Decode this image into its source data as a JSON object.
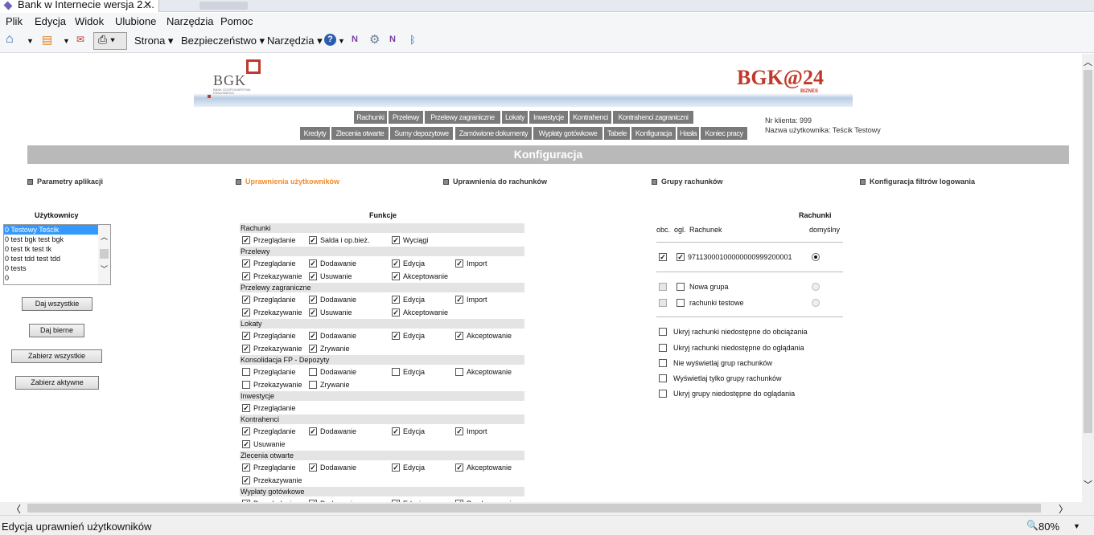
{
  "browser": {
    "tab_title": "Bank w Internecie wersja 2....",
    "tab_close": "✕",
    "menu": [
      "Plik",
      "Edycja",
      "Widok",
      "Ulubione",
      "Narzędzia",
      "Pomoc"
    ],
    "toolbar": {
      "strona": "Strona ▾",
      "bezpieczenstwo": "Bezpieczeństwo ▾",
      "narzedzia": "Narzędzia ▾"
    },
    "status_text": "Edycja uprawnień użytkowników",
    "zoom": "80%"
  },
  "banner": {
    "bgk": "BGK",
    "bgk_sub1": "BANK GOSPODARSTWA",
    "bgk_sub2": "KRAJOWEGO",
    "right_logo": "BGK@24",
    "right_sub": "BIZNES"
  },
  "nav": {
    "row1": [
      "Rachunki",
      "Przelewy",
      "Przelewy zagraniczne",
      "Lokaty",
      "Inwestycje",
      "Kontrahenci",
      "Kontrahenci zagraniczni"
    ],
    "row2": [
      "Kredyty",
      "Zlecenia otwarte",
      "Sumy depozytowe",
      "Zamówione dokumenty",
      "Wypłaty gotówkowe",
      "Tabele",
      "Konfiguracja",
      "Hasła",
      "Koniec pracy"
    ]
  },
  "client": {
    "nr_label": "Nr klienta: 999",
    "user_label": "Nazwa użytkownika: Teścik Testowy"
  },
  "section_title": "Konfiguracja",
  "sublinks": [
    "Parametry aplikacji",
    "Uprawnienia użytkowników",
    "Uprawnienia do rachunków",
    "Grupy rachunków",
    "Konfiguracja filtrów logowania"
  ],
  "users": {
    "heading": "Użytkownicy",
    "items": [
      "0 Testowy Teścik",
      "0 test bgk  test bgk",
      "0 test tk test tk",
      "0 test tdd test tdd",
      "0 tests",
      "0"
    ],
    "selected": 0,
    "buttons": [
      "Daj wszystkie",
      "Daj bierne",
      "Zabierz wszystkie",
      "Zabierz aktywne"
    ]
  },
  "functions": {
    "heading": "Funkcje",
    "groups": [
      {
        "name": "Rachunki",
        "rows": [
          [
            {
              "l": "Przeglądanie",
              "c": true
            },
            {
              "l": "Salda i op.bież.",
              "c": true
            },
            {
              "l": "Wyciągi",
              "c": true
            }
          ]
        ]
      },
      {
        "name": "Przelewy",
        "rows": [
          [
            {
              "l": "Przeglądanie",
              "c": true
            },
            {
              "l": "Dodawanie",
              "c": true
            },
            {
              "l": "Edycja",
              "c": true
            },
            {
              "l": "Import",
              "c": true
            }
          ],
          [
            {
              "l": "Przekazywanie",
              "c": true
            },
            {
              "l": "Usuwanie",
              "c": true
            },
            {
              "l": "Akceptowanie",
              "c": true
            }
          ]
        ]
      },
      {
        "name": "Przelewy zagraniczne",
        "rows": [
          [
            {
              "l": "Przeglądanie",
              "c": true
            },
            {
              "l": "Dodawanie",
              "c": true
            },
            {
              "l": "Edycja",
              "c": true
            },
            {
              "l": "Import",
              "c": true
            }
          ],
          [
            {
              "l": "Przekazywanie",
              "c": true
            },
            {
              "l": "Usuwanie",
              "c": true
            },
            {
              "l": "Akceptowanie",
              "c": true
            }
          ]
        ]
      },
      {
        "name": "Lokaty",
        "rows": [
          [
            {
              "l": "Przeglądanie",
              "c": true
            },
            {
              "l": "Dodawanie",
              "c": true
            },
            {
              "l": "Edycja",
              "c": true
            },
            {
              "l": "Akceptowanie",
              "c": true
            }
          ],
          [
            {
              "l": "Przekazywanie",
              "c": true
            },
            {
              "l": "Zrywanie",
              "c": true
            }
          ]
        ]
      },
      {
        "name": "Konsolidacja FP - Depozyty",
        "rows": [
          [
            {
              "l": "Przeglądanie",
              "c": false
            },
            {
              "l": "Dodawanie",
              "c": false
            },
            {
              "l": "Edycja",
              "c": false
            },
            {
              "l": "Akceptowanie",
              "c": false
            }
          ],
          [
            {
              "l": "Przekazywanie",
              "c": false
            },
            {
              "l": "Zrywanie",
              "c": false
            }
          ]
        ]
      },
      {
        "name": "Inwestycje",
        "rows": [
          [
            {
              "l": "Przeglądanie",
              "c": true
            }
          ]
        ]
      },
      {
        "name": "Kontrahenci",
        "rows": [
          [
            {
              "l": "Przeglądanie",
              "c": true
            },
            {
              "l": "Dodawanie",
              "c": true
            },
            {
              "l": "Edycja",
              "c": true
            },
            {
              "l": "Import",
              "c": true
            }
          ],
          [
            {
              "l": "Usuwanie",
              "c": true
            }
          ]
        ]
      },
      {
        "name": "Zlecenia otwarte",
        "rows": [
          [
            {
              "l": "Przeglądanie",
              "c": true
            },
            {
              "l": "Dodawanie",
              "c": true
            },
            {
              "l": "Edycja",
              "c": true
            },
            {
              "l": "Akceptowanie",
              "c": true
            }
          ],
          [
            {
              "l": "Przekazywanie",
              "c": true
            }
          ]
        ]
      },
      {
        "name": "Wypłaty gotówkowe",
        "rows": [
          [
            {
              "l": "Przeglądanie",
              "c": true
            },
            {
              "l": "Dodawanie",
              "c": true
            },
            {
              "l": "Edycja",
              "c": true
            },
            {
              "l": "Przekazywanie",
              "c": true
            }
          ]
        ]
      }
    ]
  },
  "accounts": {
    "heading": "Rachunki",
    "col_obc": "obc.",
    "col_ogl": "ogl.",
    "col_rachunek": "Rachunek",
    "col_domyslny": "domyślny",
    "account": "97113000100000000999200001",
    "groups": [
      "Nowa grupa",
      "rachunki testowe"
    ],
    "options": [
      "Ukryj rachunki niedostępne do obciążania",
      "Ukryj rachunki niedostępne do oglądania",
      "Nie wyświetlaj grup rachunków",
      "Wyświetlaj tylko grupy rachunków",
      "Ukryj grupy niedostępne do oglądania"
    ]
  }
}
